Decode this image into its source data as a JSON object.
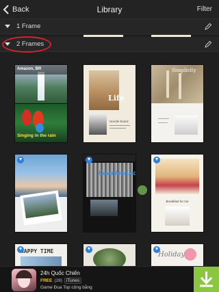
{
  "header": {
    "back_label": "Back",
    "title": "Library",
    "filter_label": "Filter"
  },
  "sections": [
    {
      "label": "1 Frame"
    },
    {
      "label": "2 Frames"
    }
  ],
  "templates": {
    "t1": {
      "location": "Amazon, BR",
      "caption": "Singing in the rain"
    },
    "t2": {
      "word": "Life",
      "text": "Needle Board"
    },
    "t3": {
      "word": "Simplicity"
    },
    "t4": {},
    "t5": {
      "brand": "Download.com"
    },
    "t6": {
      "caption": "Breakfast for me"
    },
    "t7": {
      "text": "HAPPY TIME"
    },
    "t8": {},
    "t9": {
      "text": "Holiday"
    }
  },
  "ad": {
    "app_name": "24h Quốc Chiến",
    "price": "FREE",
    "rating_count": "(28)",
    "store": "iTunes",
    "description": "Game Đua Top cộng bằng"
  },
  "colors": {
    "background": "#1f1f1f",
    "highlight": "#d7222f",
    "download_badge": "#2f7ed8",
    "ad_button": "#8cc63f"
  }
}
